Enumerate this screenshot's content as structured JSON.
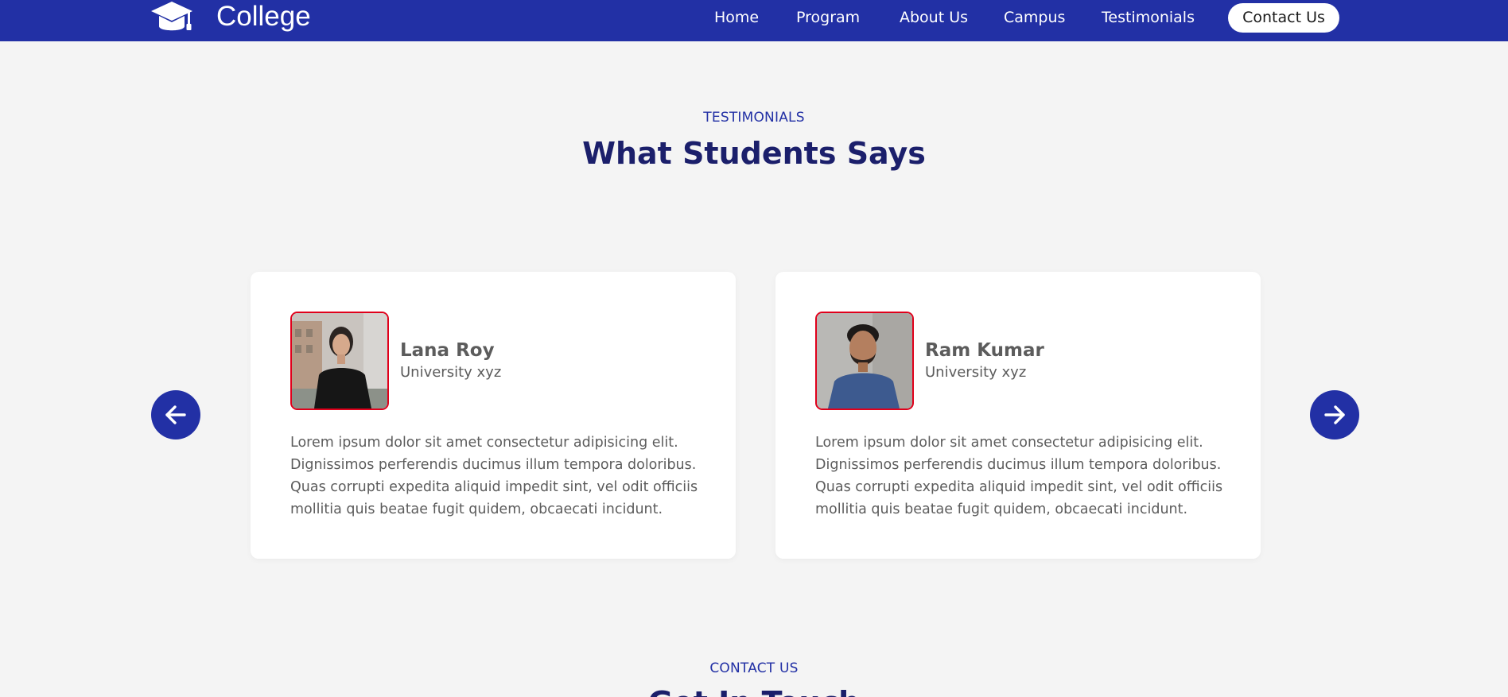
{
  "nav": {
    "brand": "College",
    "links": [
      "Home",
      "Program",
      "About Us",
      "Campus",
      "Testimonials"
    ],
    "contact_button": "Contact Us"
  },
  "testimonials": {
    "label": "TESTIMONIALS",
    "title": "What Students Says",
    "cards": [
      {
        "name": "Lana Roy",
        "school": "University xyz",
        "text": "Lorem ipsum dolor sit amet consectetur adipisicing elit. Dignissimos perferendis ducimus illum tempora doloribus. Quas corrupti expedita aliquid impedit sint, vel odit officiis mollitia quis beatae fugit quidem, obcaecati incidunt."
      },
      {
        "name": "Ram Kumar",
        "school": "University xyz",
        "text": "Lorem ipsum dolor sit amet consectetur adipisicing elit. Dignissimos perferendis ducimus illum tempora doloribus. Quas corrupti expedita aliquid impedit sint, vel odit officiis mollitia quis beatae fugit quidem, obcaecati incidunt."
      }
    ]
  },
  "contact": {
    "label": "CONTACT US",
    "title": "Get In Touch"
  },
  "icons": {
    "logo": "graduation-cap-icon",
    "prev": "arrow-left-icon",
    "next": "arrow-right-icon"
  },
  "colors": {
    "brand": "#2230a5",
    "heading": "#1b1f6b",
    "avatar_border": "#e0001b",
    "background": "#f4f4f4"
  }
}
